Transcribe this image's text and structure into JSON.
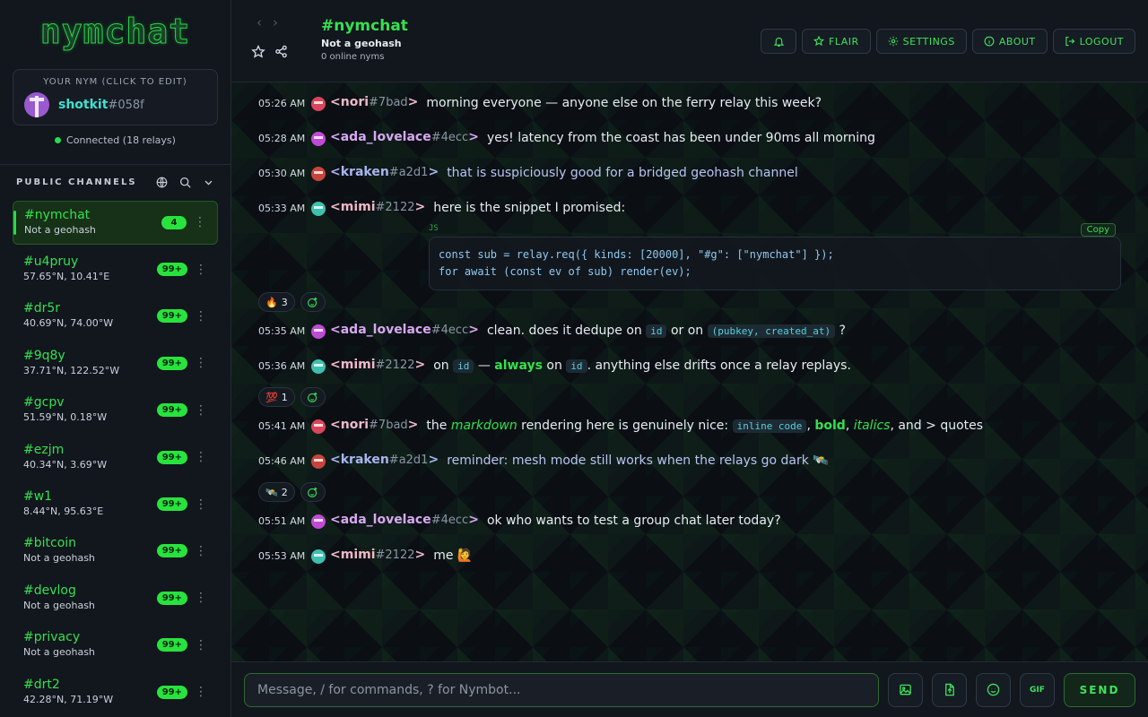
{
  "app": {
    "logo_text": "nymchat"
  },
  "nym_card": {
    "caption": "YOUR NYM (CLICK TO EDIT)",
    "name": "shotkit",
    "hash": "#058f"
  },
  "status": {
    "connected": "Connected (18 relays)"
  },
  "sidebar": {
    "section_title": "PUBLIC CHANNELS",
    "channels": [
      {
        "name": "#nymchat",
        "sub": "Not a geohash",
        "badge": "4",
        "active": true
      },
      {
        "name": "#u4pruy",
        "sub": "57.65°N, 10.41°E",
        "badge": "99+"
      },
      {
        "name": "#dr5r",
        "sub": "40.69°N, 74.00°W",
        "badge": "99+"
      },
      {
        "name": "#9q8y",
        "sub": "37.71°N, 122.52°W",
        "badge": "99+"
      },
      {
        "name": "#gcpv",
        "sub": "51.59°N, 0.18°W",
        "badge": "99+"
      },
      {
        "name": "#ezjm",
        "sub": "40.34°N, 3.69°W",
        "badge": "99+"
      },
      {
        "name": "#w1",
        "sub": "8.44°N, 95.63°E",
        "badge": "99+"
      },
      {
        "name": "#bitcoin",
        "sub": "Not a geohash",
        "badge": "99+"
      },
      {
        "name": "#devlog",
        "sub": "Not a geohash",
        "badge": "99+"
      },
      {
        "name": "#privacy",
        "sub": "Not a geohash",
        "badge": "99+"
      },
      {
        "name": "#drt2",
        "sub": "42.28°N, 71.19°W",
        "badge": "99+"
      }
    ]
  },
  "header": {
    "channel": "#nymchat",
    "subtitle": "Not a geohash",
    "online": "0 online nyms",
    "buttons": {
      "flair": "FLAIR",
      "settings": "SETTINGS",
      "about": "ABOUT",
      "logout": "LOGOUT"
    }
  },
  "messages": {
    "m1": {
      "time": "05:26 AM",
      "author": "<nori",
      "hash": "#7bad",
      "close": ">",
      "text": "morning everyone — anyone else on the ferry relay this week?"
    },
    "m2": {
      "time": "05:28 AM",
      "author": "<ada_lovelace",
      "hash": "#4ecc",
      "close": ">",
      "text": "yes! latency from the coast has been under 90ms all morning"
    },
    "m3": {
      "time": "05:30 AM",
      "author": "<kraken",
      "hash": "#a2d1",
      "close": ">",
      "text": "that is suspiciously good for a bridged geohash channel"
    },
    "m4": {
      "time": "05:33 AM",
      "author": "<mimi",
      "hash": "#2122",
      "close": ">",
      "text": "here is the snippet I promised:"
    },
    "code": {
      "lang": "JS",
      "copy": "Copy",
      "line1": "const sub = relay.req({ kinds: [20000], \"#g\": [\"nymchat\"] });",
      "line2": "for await (const ev of sub) render(ev);"
    },
    "r1": {
      "emoji": "🔥",
      "count": "3"
    },
    "m5": {
      "time": "05:35 AM",
      "author": "<ada_lovelace",
      "hash": "#4ecc",
      "close": ">",
      "t1": "clean. does it dedupe on",
      "c1": "id",
      "t2": "or on",
      "c2": "(pubkey, created_at)",
      "t3": "?"
    },
    "m6": {
      "time": "05:36 AM",
      "author": "<mimi",
      "hash": "#2122",
      "close": ">",
      "t1": "on",
      "c1": "id",
      "t2": "—",
      "b1": "always",
      "t3": "on",
      "c2": "id",
      "t4": ". anything else drifts once a relay replays."
    },
    "r2": {
      "emoji": "💯",
      "count": "1"
    },
    "m7": {
      "time": "05:41 AM",
      "author": "<nori",
      "hash": "#7bad",
      "close": ">",
      "t1": "the",
      "i1": "markdown",
      "t2": "rendering here is genuinely nice:",
      "c1": "inline code",
      "t3": ",",
      "b1": "bold",
      "t4": ",",
      "i2": "italics",
      "t5": ", and > quotes"
    },
    "m8": {
      "time": "05:46 AM",
      "author": "<kraken",
      "hash": "#a2d1",
      "close": ">",
      "text": "reminder: mesh mode still works when the relays go dark 🛰️"
    },
    "r3": {
      "emoji": "🛰️",
      "count": "2"
    },
    "m9": {
      "time": "05:51 AM",
      "author": "<ada_lovelace",
      "hash": "#4ecc",
      "close": ">",
      "text": "ok who wants to test a group chat later today?"
    },
    "m10": {
      "time": "05:53 AM",
      "author": "<mimi",
      "hash": "#2122",
      "close": ">",
      "text": "me 🙋"
    }
  },
  "composer": {
    "placeholder": "Message, / for commands, ? for Nymbot...",
    "gif_label": "GIF",
    "send_label": "SEND"
  },
  "colors": {
    "accent": "#35e04f",
    "nori": "#f0b8c8",
    "ada": "#d7a8f0",
    "kraken": "#a8b4f0",
    "mimi": "#f0b8c8"
  }
}
